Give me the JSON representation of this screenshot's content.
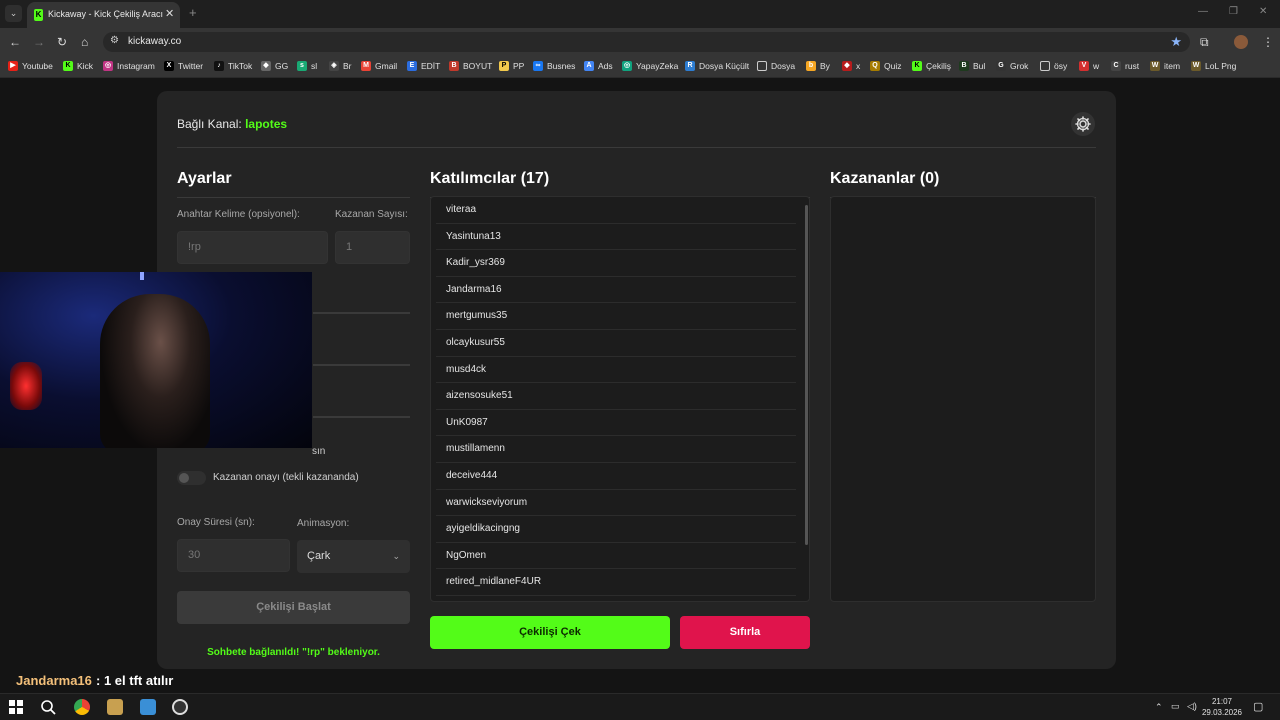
{
  "browser": {
    "tab_title": "Kickaway - Kick Çekiliş Aracı",
    "url": "kickaway.co",
    "bookmarks": [
      "Youtube",
      "Kick",
      "Instagram",
      "Twitter",
      "TikTok",
      "GG",
      "sl",
      "Br",
      "Gmail",
      "EDİT",
      "BOYUT",
      "PP",
      "Busnes",
      "Ads",
      "YapayZeka",
      "Dosya Küçült",
      "Dosya",
      "By",
      "x",
      "Quiz",
      "Çekiliş",
      "Bul",
      "Grok",
      "ösy",
      "w",
      "rust",
      "item",
      "LoL Png"
    ]
  },
  "header": {
    "channel_label": "Bağlı Kanal:",
    "channel_name": "lapotes"
  },
  "settings": {
    "title": "Ayarlar",
    "keyword_label": "Anahtar Kelime (opsiyonel):",
    "keyword_placeholder": "!rp",
    "winner_count_label": "Kazanan Sayısı:",
    "winner_count_placeholder": "1",
    "partial_toggle_text": "sın",
    "approval_toggle_label": "Kazanan onayı (tekli kazananda)",
    "approval_time_label": "Onay Süresi (sn):",
    "approval_time_placeholder": "30",
    "animation_label": "Animasyon:",
    "animation_value": "Çark",
    "start_button": "Çekilişi Başlat",
    "status": "Sohbete bağlanıldı! \"!rp\" bekleniyor."
  },
  "participants": {
    "title": "Katılımcılar (17)",
    "items": [
      "viteraa",
      "Yasintuna13",
      "Kadir_ysr369",
      "Jandarma16",
      "mertgumus35",
      "olcaykusur55",
      "musd4ck",
      "aizensosuke51",
      "UnK0987",
      "mustillamenn",
      "deceive444",
      "warwickseviyorum",
      "ayigeldikacingng",
      "NgOmen",
      "retired_midlaneF4UR"
    ],
    "draw_button": "Çekilişi Çek",
    "reset_button": "Sıfırla"
  },
  "winners": {
    "title": "Kazananlar (0)"
  },
  "chat_overlay": {
    "username": "Jandarma16",
    "message": ": 1 el tft atılır"
  },
  "taskbar": {
    "time": "21:07",
    "date": "29.03.2026"
  },
  "colors": {
    "accent_green": "#53fc18",
    "reset_red": "#e0144c",
    "card_bg": "#242424"
  }
}
